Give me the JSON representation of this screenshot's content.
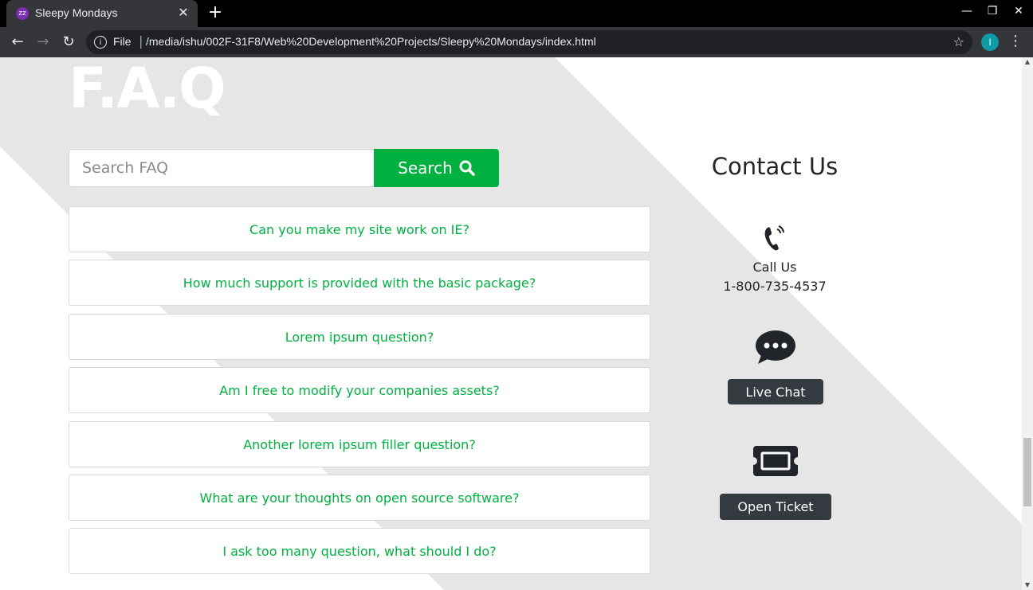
{
  "browser": {
    "tab_title": "Sleepy Mondays",
    "favicon_text": "zz",
    "url_scheme": "File",
    "url": "/media/ishu/002F-31F8/Web%20Development%20Projects/Sleepy%20Mondays/index.html",
    "profile_initial": "I"
  },
  "page": {
    "heading": "F.A.Q",
    "search": {
      "placeholder": "Search FAQ",
      "value": "",
      "button_label": "Search"
    },
    "faq_items": [
      "Can you make my site work on IE?",
      "How much support is provided with the basic package?",
      "Lorem ipsum question?",
      "Am I free to modify your companies assets?",
      "Another lorem ipsum filler question?",
      "What are your thoughts on open source software?",
      "I ask too many question, what should I do?"
    ],
    "contact": {
      "title": "Contact Us",
      "call_label": "Call Us",
      "phone": "1-800-735-4537",
      "chat_button": "Live Chat",
      "ticket_button": "Open Ticket"
    }
  },
  "colors": {
    "accent_green": "#00b140",
    "dark_button": "#343a40",
    "background_shape": "#e6e6e6"
  }
}
